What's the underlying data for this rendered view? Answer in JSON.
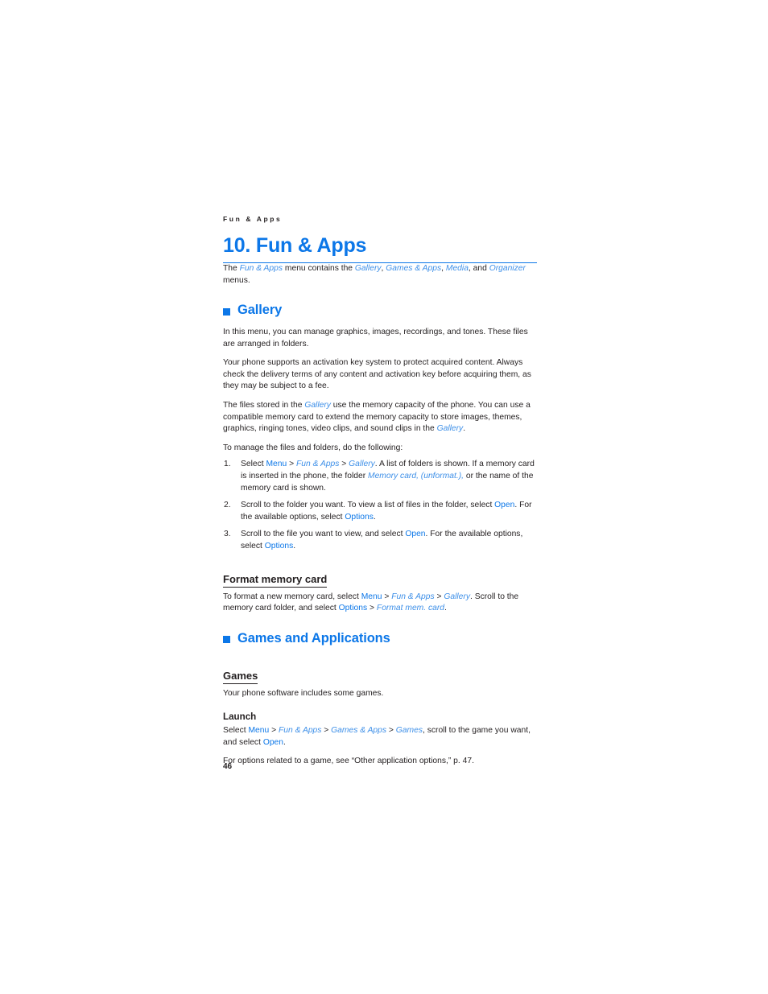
{
  "document": {
    "running_header": "Fun & Apps",
    "chapter_title": "10. Fun & Apps",
    "page_number": "46",
    "accent_color": "#0c77e8",
    "link_italic_color": "#3d8fe8",
    "text_color": "#231f20"
  },
  "intro": {
    "t1": "The ",
    "m1": "Fun & Apps",
    "t2": " menu contains the ",
    "m2": "Gallery",
    "t3": ", ",
    "m3": "Games & Apps",
    "t4": ", ",
    "m4": "Media",
    "t5": ", and ",
    "m5": "Organizer",
    "t6": " menus."
  },
  "gallery": {
    "heading": "Gallery",
    "p1": "In this menu, you can manage graphics, images, recordings, and tones. These files are arranged in folders.",
    "p2": "Your phone supports an activation key system to protect acquired content. Always check the delivery terms of any content and activation key before acquiring them, as they may be subject to a fee.",
    "p3": {
      "t1": "The files stored in the ",
      "m1": "Gallery",
      "t2": " use the memory capacity of the phone. You can use a compatible memory card to extend the memory capacity to store images, themes, graphics, ringing tones, video clips, and sound clips in the ",
      "m2": "Gallery",
      "t3": "."
    },
    "p4": "To manage the files and folders, do the following:",
    "steps": [
      {
        "num": "1.",
        "t1": "Select ",
        "ui1": "Menu",
        "s1": " > ",
        "m1": "Fun & Apps",
        "s2": " > ",
        "m2": "Gallery",
        "t2": ". A list of folders is shown. If a memory card is inserted in the phone, the folder ",
        "m3": "Memory card, (unformat.),",
        "t3": " or the name of the memory card is shown."
      },
      {
        "num": "2.",
        "t1": "Scroll to the folder you want. To view a list of files in the folder, select ",
        "ui1": "Open",
        "t2": ". For the available options, select ",
        "ui2": "Options",
        "t3": "."
      },
      {
        "num": "3.",
        "t1": "Scroll to the file you want to view, and select ",
        "ui1": "Open",
        "t2": ". For the available options, select ",
        "ui2": "Options",
        "t3": "."
      }
    ],
    "format_card": {
      "heading": "Format memory card",
      "t1": "To format a new memory card, select ",
      "ui1": "Menu",
      "s1": " > ",
      "m1": "Fun & Apps",
      "s2": " > ",
      "m2": "Gallery",
      "t2": ". Scroll to the memory card folder, and select ",
      "ui2": "Options",
      "s3": " > ",
      "m3": "Format mem. card",
      "t3": "."
    }
  },
  "games_apps": {
    "heading": "Games and Applications",
    "games": {
      "heading": "Games",
      "p1": "Your phone software includes some games."
    },
    "launch": {
      "heading": "Launch",
      "t1": "Select ",
      "ui1": "Menu",
      "s1": " > ",
      "m1": "Fun & Apps",
      "s2": " > ",
      "m2": "Games & Apps",
      "s3": " > ",
      "m3": "Games",
      "t2": ", scroll to the game you want, and select ",
      "ui2": "Open",
      "t3": ".",
      "p2": "For options related to a game, see “Other application options,” p. 47."
    }
  }
}
